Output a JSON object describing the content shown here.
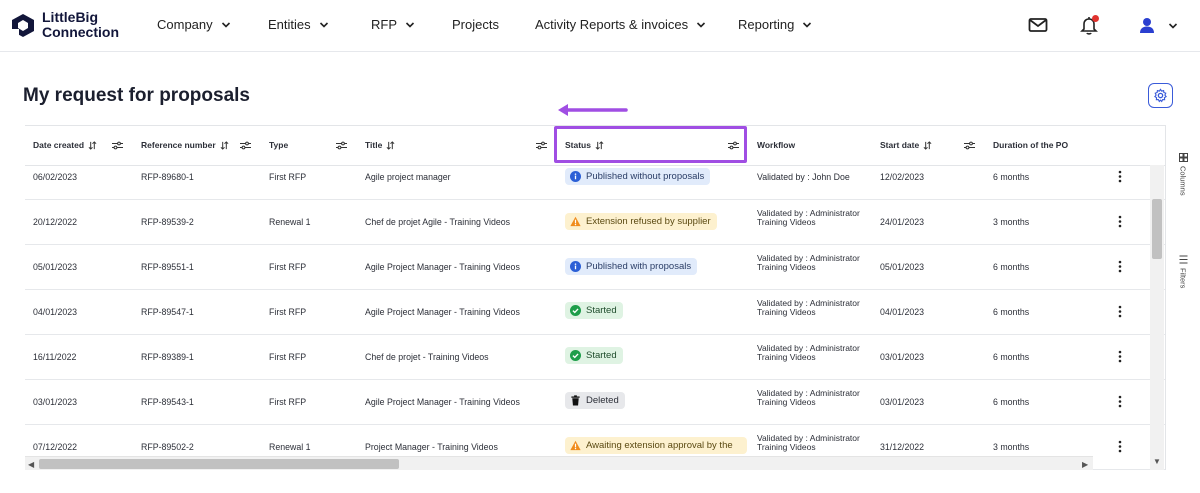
{
  "brand": {
    "name_line1": "LittleBig",
    "name_line2": "Connection"
  },
  "nav": {
    "items": [
      {
        "label": "Company",
        "has_dropdown": true
      },
      {
        "label": "Entities",
        "has_dropdown": true
      },
      {
        "label": "RFP",
        "has_dropdown": true
      },
      {
        "label": "Projects",
        "has_dropdown": false
      },
      {
        "label": "Activity Reports & invoices",
        "has_dropdown": true
      },
      {
        "label": "Reporting",
        "has_dropdown": true
      }
    ],
    "icons": [
      "mail-icon",
      "bell-icon",
      "user-icon"
    ]
  },
  "page": {
    "title": "My request for proposals"
  },
  "table": {
    "columns": [
      "Date created",
      "Reference number",
      "Type",
      "Title",
      "Status",
      "Workflow",
      "Start date",
      "Duration of the PO"
    ],
    "rows": [
      {
        "date": "06/02/2023",
        "ref": "RFP-89680-1",
        "type": "First RFP",
        "title": "Agile project manager",
        "status": "Published without proposals",
        "status_kind": "info",
        "workflow": "Validated by : John Doe",
        "start": "12/02/2023",
        "duration": "6 months"
      },
      {
        "date": "20/12/2022",
        "ref": "RFP-89539-2",
        "type": "Renewal 1",
        "title": "Chef de projet Agile - Training Videos",
        "status": "Extension refused by supplier",
        "status_kind": "warn",
        "workflow": "Validated by : Administrator Training Videos",
        "start": "24/01/2023",
        "duration": "3 months"
      },
      {
        "date": "05/01/2023",
        "ref": "RFP-89551-1",
        "type": "First RFP",
        "title": "Agile Project Manager - Training Videos",
        "status": "Published with proposals",
        "status_kind": "info",
        "workflow": "Validated by : Administrator Training Videos",
        "start": "05/01/2023",
        "duration": "6 months"
      },
      {
        "date": "04/01/2023",
        "ref": "RFP-89547-1",
        "type": "First RFP",
        "title": "Agile Project Manager - Training Videos",
        "status": "Started",
        "status_kind": "ok",
        "workflow": "Validated by : Administrator Training Videos",
        "start": "04/01/2023",
        "duration": "6 months"
      },
      {
        "date": "16/11/2022",
        "ref": "RFP-89389-1",
        "type": "First RFP",
        "title": "Chef de projet - Training Videos",
        "status": "Started",
        "status_kind": "ok",
        "workflow": "Validated by : Administrator Training Videos",
        "start": "03/01/2023",
        "duration": "6 months"
      },
      {
        "date": "03/01/2023",
        "ref": "RFP-89543-1",
        "type": "First RFP",
        "title": "Agile Project Manager - Training Videos",
        "status": "Deleted",
        "status_kind": "del",
        "workflow": "Validated by : Administrator Training Videos",
        "start": "03/01/2023",
        "duration": "6 months"
      },
      {
        "date": "07/12/2022",
        "ref": "RFP-89502-2",
        "type": "Renewal 1",
        "title": "Project Manager - Training Videos",
        "status": "Awaiting extension approval by the",
        "status_kind": "warn",
        "workflow": "Validated by : Administrator Training Videos",
        "start": "31/12/2022",
        "duration": "3 months"
      }
    ]
  },
  "side_panel": {
    "columns_label": "Columns",
    "filters_label": "Filters"
  },
  "colors": {
    "accent": "#3a5bd9",
    "highlight": "#a04ee3"
  }
}
